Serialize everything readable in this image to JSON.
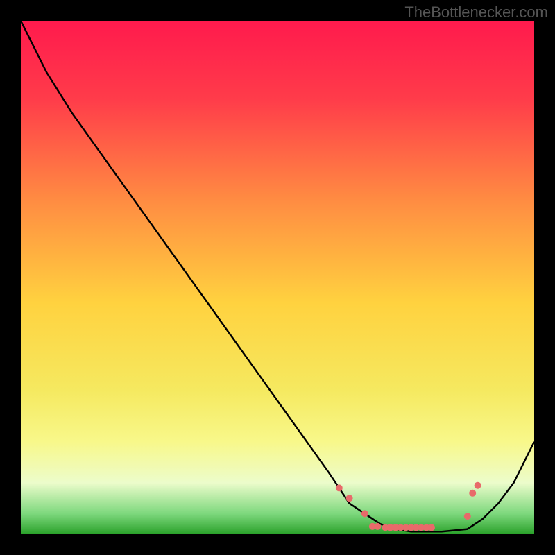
{
  "watermark": "TheBottlenecker.com",
  "chart_data": {
    "type": "line",
    "title": "",
    "xlabel": "",
    "ylabel": "",
    "xlim": [
      0,
      100
    ],
    "ylim": [
      0,
      100
    ],
    "background": {
      "type": "vertical-gradient",
      "stops": [
        {
          "pos": 0.0,
          "color": "#ff1a4d"
        },
        {
          "pos": 0.15,
          "color": "#ff3b4a"
        },
        {
          "pos": 0.35,
          "color": "#ff8c42"
        },
        {
          "pos": 0.55,
          "color": "#ffd23f"
        },
        {
          "pos": 0.72,
          "color": "#f5e960"
        },
        {
          "pos": 0.82,
          "color": "#f8f88a"
        },
        {
          "pos": 0.9,
          "color": "#ecfccb"
        },
        {
          "pos": 0.96,
          "color": "#7dd87d"
        },
        {
          "pos": 1.0,
          "color": "#2aa12a"
        }
      ]
    },
    "series": [
      {
        "name": "curve",
        "color": "#000000",
        "x": [
          0,
          4,
          5,
          10,
          20,
          30,
          40,
          50,
          60,
          64,
          67,
          70,
          73,
          76,
          82,
          87,
          90,
          93,
          96,
          100
        ],
        "y": [
          100,
          92,
          90,
          82,
          68,
          54,
          40,
          26,
          12,
          6,
          4,
          2,
          1,
          0.5,
          0.5,
          1,
          3,
          6,
          10,
          18
        ]
      }
    ],
    "markers": {
      "name": "bottleneck-points",
      "color": "#e86a6a",
      "radius": 5,
      "x": [
        62,
        64,
        67,
        68.5,
        69.5,
        71,
        72,
        73,
        74,
        75,
        76,
        77,
        78,
        79,
        80,
        87,
        88,
        89
      ],
      "y": [
        9,
        7,
        4,
        1.5,
        1.5,
        1.3,
        1.3,
        1.3,
        1.3,
        1.3,
        1.3,
        1.3,
        1.3,
        1.3,
        1.3,
        3.5,
        8,
        9.5
      ]
    }
  }
}
